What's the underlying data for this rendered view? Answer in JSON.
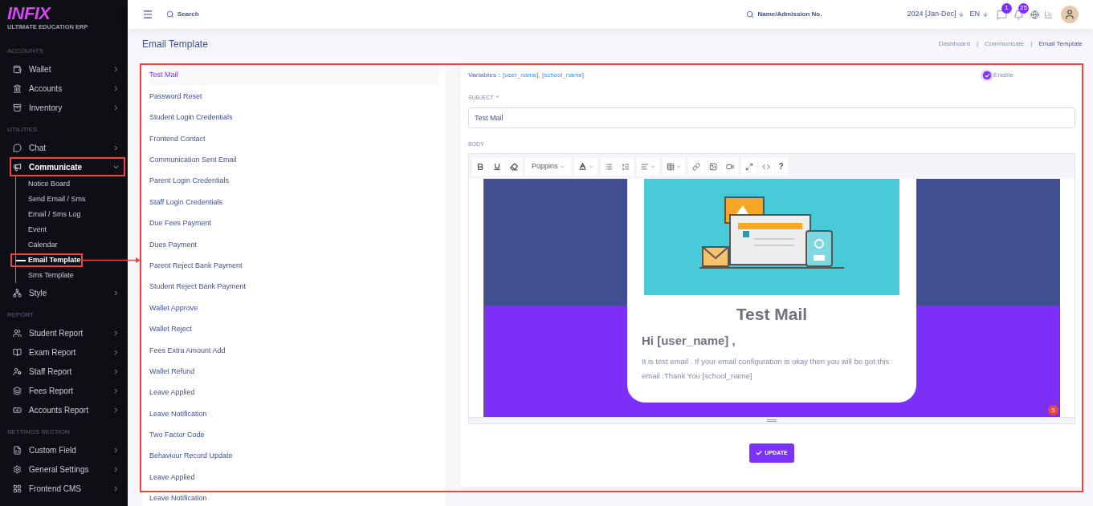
{
  "brand": {
    "name": "INFIX",
    "tagline": "ULTIMATE EDUCATION ERP"
  },
  "sidebar": {
    "sections": [
      {
        "title": "ACCOUNTS",
        "items": [
          {
            "label": "Wallet",
            "expanded": false
          },
          {
            "label": "Accounts",
            "expanded": false
          },
          {
            "label": "Inventory",
            "expanded": false
          }
        ]
      },
      {
        "title": "UTILITIES",
        "items": [
          {
            "label": "Chat",
            "expanded": false
          },
          {
            "label": "Communicate",
            "expanded": true,
            "children": [
              {
                "label": "Notice Board",
                "selected": false
              },
              {
                "label": "Send Email / Sms",
                "selected": false
              },
              {
                "label": "Email / Sms Log",
                "selected": false
              },
              {
                "label": "Event",
                "selected": false
              },
              {
                "label": "Calendar",
                "selected": false
              },
              {
                "label": "Email Template",
                "selected": true
              },
              {
                "label": "Sms Template",
                "selected": false
              }
            ]
          },
          {
            "label": "Style",
            "expanded": false
          }
        ]
      },
      {
        "title": "REPORT",
        "items": [
          {
            "label": "Student Report",
            "expanded": false
          },
          {
            "label": "Exam Report",
            "expanded": false
          },
          {
            "label": "Staff Report",
            "expanded": false
          },
          {
            "label": "Fees Report",
            "expanded": false
          },
          {
            "label": "Accounts Report",
            "expanded": false
          }
        ]
      },
      {
        "title": "SETTINGS SECTION",
        "items": [
          {
            "label": "Custom Field",
            "expanded": false
          },
          {
            "label": "General Settings",
            "expanded": false
          },
          {
            "label": "Frontend CMS",
            "expanded": false
          }
        ]
      }
    ]
  },
  "header": {
    "search": {
      "placeholder": "Search"
    },
    "student_search": {
      "placeholder": "Name/Admission No."
    },
    "session": "2024 [Jan-Dec]",
    "language": "EN",
    "chat_badge": "1",
    "notification_badge": "25"
  },
  "page": {
    "title": "Email Template",
    "separator": "|",
    "breadcrumb": [
      "Dashboard",
      "Communicate",
      "Email Template"
    ]
  },
  "templates": [
    {
      "label": "Test Mail",
      "selected": true
    },
    {
      "label": "Password Reset",
      "selected": false
    },
    {
      "label": "Student Login Credentials",
      "selected": false
    },
    {
      "label": "Frontend Contact",
      "selected": false
    },
    {
      "label": "Communication Sent Email",
      "selected": false
    },
    {
      "label": "Parent Login Credentials",
      "selected": false
    },
    {
      "label": "Staff Login Credentials",
      "selected": false
    },
    {
      "label": "Due Fees Payment",
      "selected": false
    },
    {
      "label": "Dues Payment",
      "selected": false
    },
    {
      "label": "Parent Reject Bank Payment",
      "selected": false
    },
    {
      "label": "Student Reject Bank Payment",
      "selected": false
    },
    {
      "label": "Wallet Approve",
      "selected": false
    },
    {
      "label": "Wallet Reject",
      "selected": false
    },
    {
      "label": "Fees Extra Amount Add",
      "selected": false
    },
    {
      "label": "Wallet Refund",
      "selected": false
    },
    {
      "label": "Leave Applied",
      "selected": false
    },
    {
      "label": "Leave Notification",
      "selected": false
    },
    {
      "label": "Two Factor Code",
      "selected": false
    },
    {
      "label": "Behaviour Record Update",
      "selected": false
    },
    {
      "label": "Leave Applied",
      "selected": false
    },
    {
      "label": "Leave Notification",
      "selected": false
    }
  ],
  "editor": {
    "variables_label": "Variables :",
    "variables": "[user_name], [school_name]",
    "enable": {
      "label": "Enable",
      "checked": true
    },
    "subject": {
      "label": "SUBJECT",
      "required_mark": "*",
      "value": "Test Mail"
    },
    "body_label": "BODY",
    "font": "Poppins",
    "help": "?",
    "preview": {
      "title": "Test Mail",
      "greeting": "Hi [user_name] ,",
      "message": "It is test email . If your email configuration is okay then you will be got this email .Thank You [school_name]"
    },
    "corner_badge": "5",
    "update": "UPDATE"
  }
}
